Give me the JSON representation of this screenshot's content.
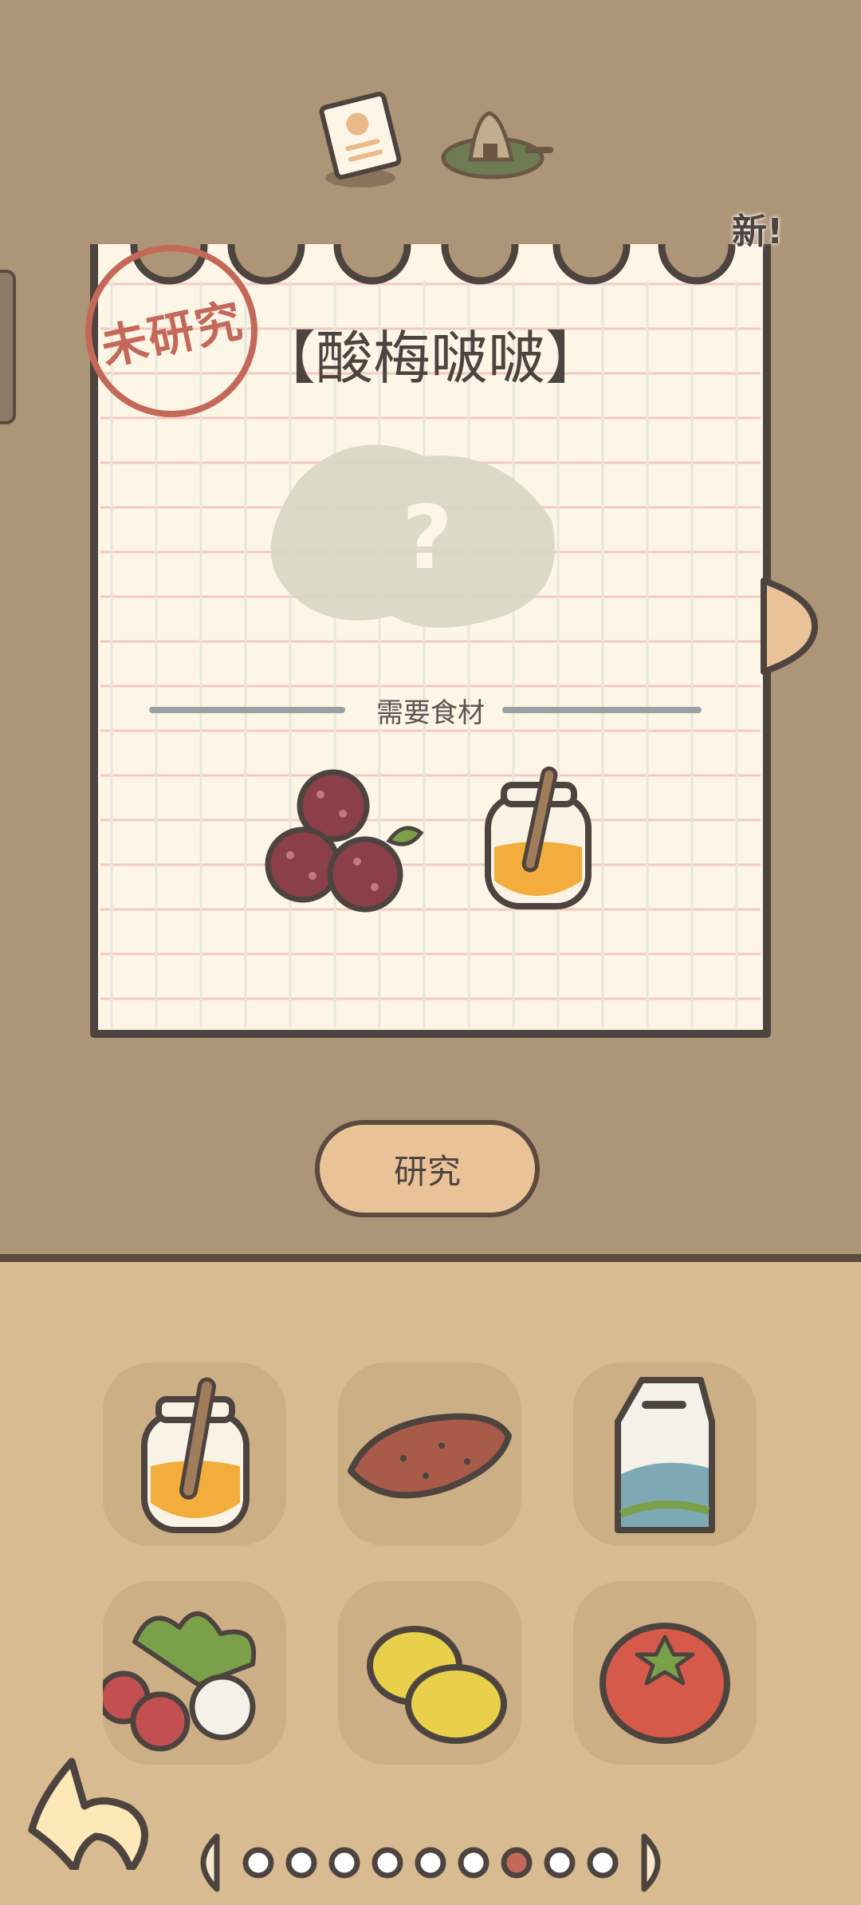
{
  "recipe": {
    "status_stamp": "未研究",
    "title": "【酸梅啵啵】",
    "new_badge": "新!",
    "ingredients_label": "需要食材",
    "required_ingredients": [
      "bayberries",
      "honey-jar"
    ]
  },
  "actions": {
    "research_label": "研究"
  },
  "inventory": {
    "items": [
      "honey-jar",
      "sweet-potato",
      "milk-carton",
      "radishes",
      "lemons",
      "tomato"
    ]
  },
  "pagination": {
    "total": 9,
    "current": 7
  },
  "colors": {
    "background_top": "#ad9577",
    "background_bottom": "#d9bb91",
    "slot": "#cdaf86",
    "paper": "#fdf6e6",
    "outline": "#5a4a40",
    "stamp": "#c4695a",
    "button": "#e9c397",
    "active_dot": "#c4695a"
  }
}
